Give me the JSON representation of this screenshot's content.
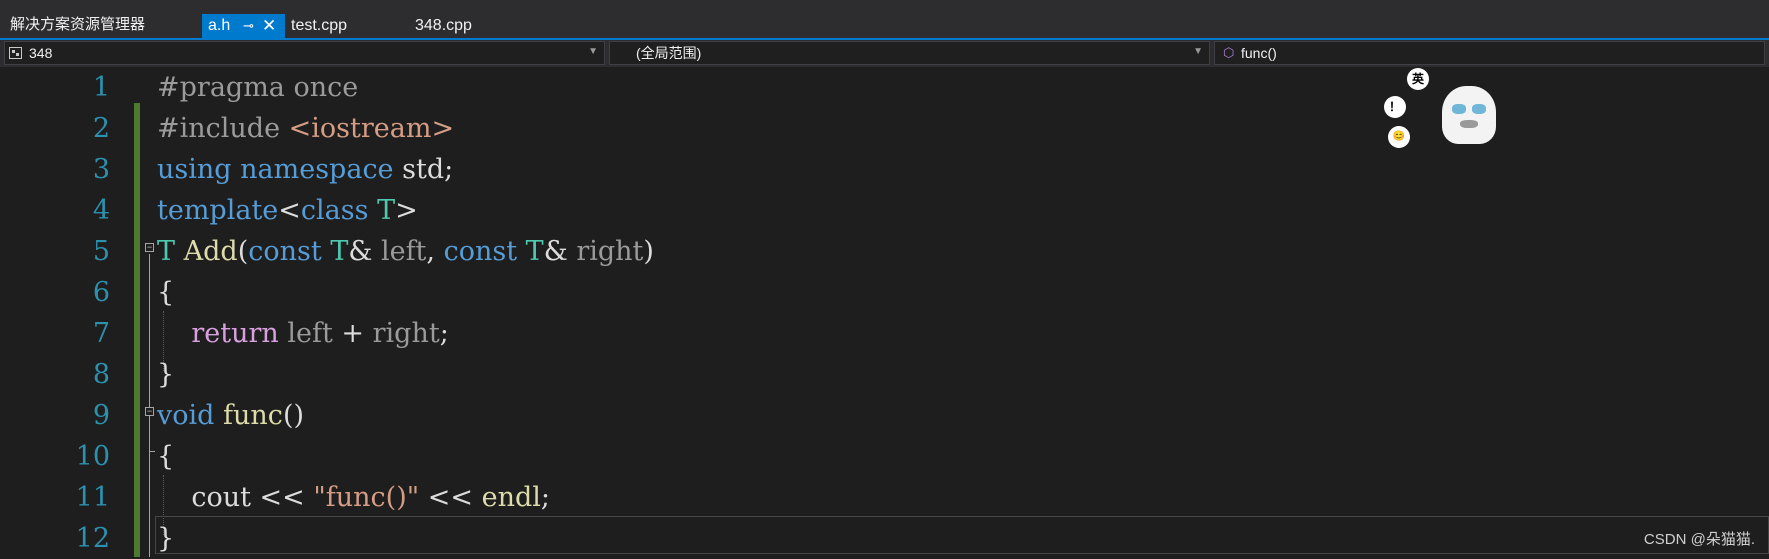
{
  "tabs": {
    "solution_explorer": "解决方案资源管理器",
    "items": [
      {
        "label": "a.h"
      },
      {
        "label": "test.cpp"
      },
      {
        "label": "348.cpp"
      }
    ]
  },
  "navbar": {
    "project": "348",
    "scope": "(全局范围)",
    "member": "func()"
  },
  "editor": {
    "line_numbers": [
      "1",
      "2",
      "3",
      "4",
      "5",
      "6",
      "7",
      "8",
      "9",
      "10",
      "11",
      "12"
    ]
  },
  "code": {
    "l1": {
      "a": "#pragma once"
    },
    "l2": {
      "a": "#include ",
      "b": "<iostream>"
    },
    "l3": {
      "a": "using namespace",
      "b": " std;"
    },
    "l4": {
      "a": "template",
      "b": "<",
      "c": "class",
      "d": " ",
      "e": "T",
      "f": ">"
    },
    "l5": {
      "a": "T",
      "b": " ",
      "c": "Add",
      "d": "(",
      "e": "const",
      "f": " ",
      "g": "T",
      "h": "& ",
      "i": "left",
      "j": ", ",
      "k": "const",
      "l": " ",
      "m": "T",
      "n": "& ",
      "o": "right",
      "p": ")"
    },
    "l6": {
      "a": "{"
    },
    "l7": {
      "a": "    ",
      "b": "return",
      "c": " ",
      "d": "left",
      "e": " + ",
      "f": "right",
      "g": ";"
    },
    "l8": {
      "a": "}"
    },
    "l9": {
      "a": "void",
      "b": " ",
      "c": "func",
      "d": "()"
    },
    "l10": {
      "a": "{"
    },
    "l11": {
      "a": "    cout << ",
      "b": "\"func()\"",
      "c": " << ",
      "d": "endl",
      "e": ";"
    },
    "l12": {
      "a": "}"
    }
  },
  "sticker": {
    "bubble1": "英",
    "bubble2": "！",
    "bubble3": "😊"
  },
  "watermark": "CSDN @朵猫猫."
}
